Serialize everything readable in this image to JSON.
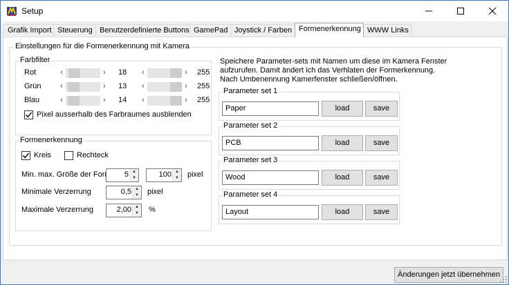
{
  "window": {
    "title": "Setup"
  },
  "tabs": [
    {
      "label": "Grafik Import"
    },
    {
      "label": "Steuerung"
    },
    {
      "label": "Benutzerdefinierte Buttons"
    },
    {
      "label": "GamePad"
    },
    {
      "label": "Joystick / Farben"
    },
    {
      "label": "Formenerkennung",
      "active": true
    },
    {
      "label": "WWW Links"
    }
  ],
  "main": {
    "group_title": "Einstellungen für die Formenerkennung mit Kamera",
    "farbfilter": {
      "title": "Farbfilter",
      "rows": [
        {
          "label": "Rot",
          "min": "18",
          "max": "255"
        },
        {
          "label": "Grün",
          "min": "13",
          "max": "255"
        },
        {
          "label": "Blau",
          "min": "14",
          "max": "255"
        }
      ],
      "outside_label": "Pixel ausserhalb des Farbraumes ausblenden",
      "outside_checked": true
    },
    "formenerkennung": {
      "title": "Formenerkennung",
      "kreis_label": "Kreis",
      "kreis_checked": true,
      "rechteck_label": "Rechteck",
      "rechteck_checked": false,
      "size_label": "Min. max. Größe der Form",
      "size_min": "5",
      "size_max": "100",
      "size_unit": "pixel",
      "minvz_label": "Minimale Verzerrung",
      "minvz_value": "0,5",
      "minvz_unit": "pixel",
      "maxvz_label": "Maximale Verzerrung",
      "maxvz_value": "2,00",
      "maxvz_unit": "%"
    },
    "info_text": [
      "Speichere Parameter-sets mit Namen um diese im Kamera Fenster",
      "aufzurufen. Damit ändert ich das Verhlaten der Formerkennung.",
      "Nach Umbenennung Kamerfenster schließen/öffnen."
    ],
    "param_sets": [
      {
        "title": "Parameter set 1",
        "name": "Paper"
      },
      {
        "title": "Parameter set 2",
        "name": "PCB"
      },
      {
        "title": "Parameter set 3",
        "name": "Wood"
      },
      {
        "title": "Parameter set 4",
        "name": "Layout"
      }
    ],
    "load_label": "load",
    "save_label": "save"
  },
  "footer": {
    "apply_label": "Änderungen jetzt übernehmen"
  }
}
